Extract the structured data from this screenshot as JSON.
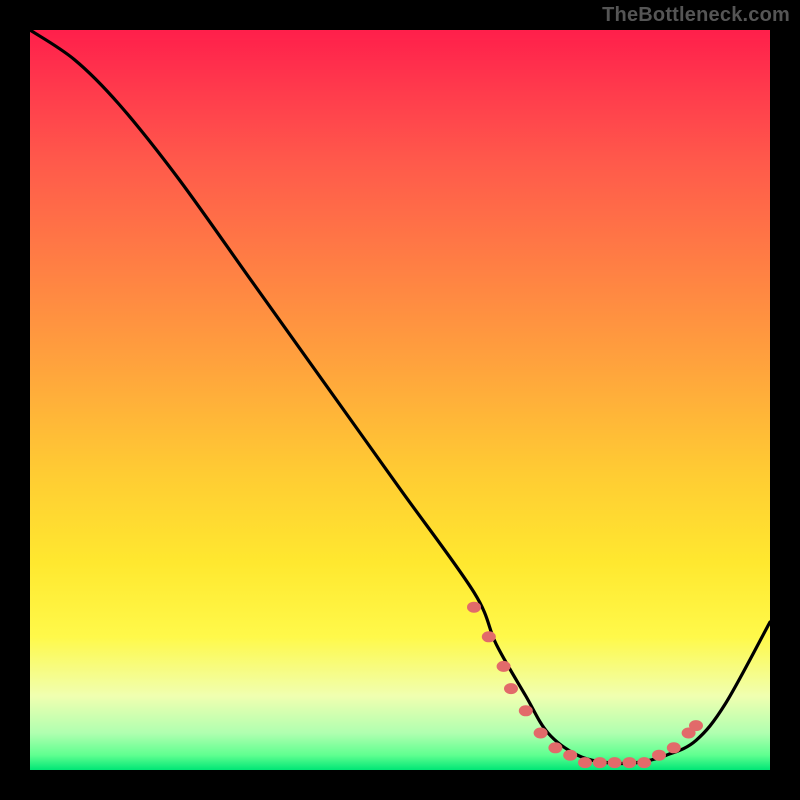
{
  "watermark": "TheBottleneck.com",
  "chart_data": {
    "type": "line",
    "title": "",
    "xlabel": "",
    "ylabel": "",
    "xlim": [
      0,
      100
    ],
    "ylim": [
      0,
      100
    ],
    "gradient_colors_top_to_bottom": [
      "#ff1f4b",
      "#ff5a4b",
      "#ffa23d",
      "#ffe82f",
      "#f0ffb0",
      "#00e676"
    ],
    "series": [
      {
        "name": "bottleneck-curve",
        "x": [
          0,
          6,
          12,
          20,
          30,
          40,
          50,
          60,
          63,
          67,
          70,
          74,
          78,
          82,
          86,
          90,
          94,
          100
        ],
        "values": [
          100,
          96,
          90,
          80,
          66,
          52,
          38,
          24,
          17,
          10,
          5,
          2,
          1,
          1,
          2,
          4,
          9,
          20
        ]
      }
    ],
    "markers": {
      "name": "dotted-band",
      "color": "#e26a6a",
      "points": [
        {
          "x": 60,
          "y": 22
        },
        {
          "x": 62,
          "y": 18
        },
        {
          "x": 64,
          "y": 14
        },
        {
          "x": 65,
          "y": 11
        },
        {
          "x": 67,
          "y": 8
        },
        {
          "x": 69,
          "y": 5
        },
        {
          "x": 71,
          "y": 3
        },
        {
          "x": 73,
          "y": 2
        },
        {
          "x": 75,
          "y": 1
        },
        {
          "x": 77,
          "y": 1
        },
        {
          "x": 79,
          "y": 1
        },
        {
          "x": 81,
          "y": 1
        },
        {
          "x": 83,
          "y": 1
        },
        {
          "x": 85,
          "y": 2
        },
        {
          "x": 87,
          "y": 3
        },
        {
          "x": 89,
          "y": 5
        },
        {
          "x": 90,
          "y": 6
        }
      ]
    }
  }
}
